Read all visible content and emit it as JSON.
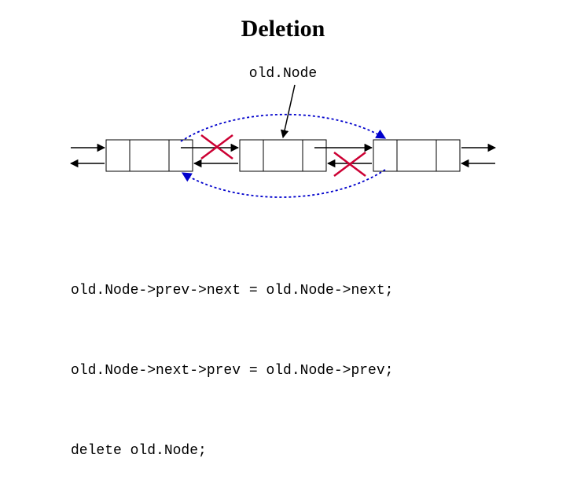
{
  "title": "Deletion",
  "label": "old.Node",
  "code": {
    "line1": "old.Node->prev->next = old.Node->next;",
    "line2": "old.Node->next->prev = old.Node->prev;",
    "line3": "delete old.Node;"
  },
  "colors": {
    "node_fill": "#ffffff",
    "node_stroke": "#000000",
    "bypass_arrow": "#0000cc",
    "cross": "#cc0033"
  }
}
